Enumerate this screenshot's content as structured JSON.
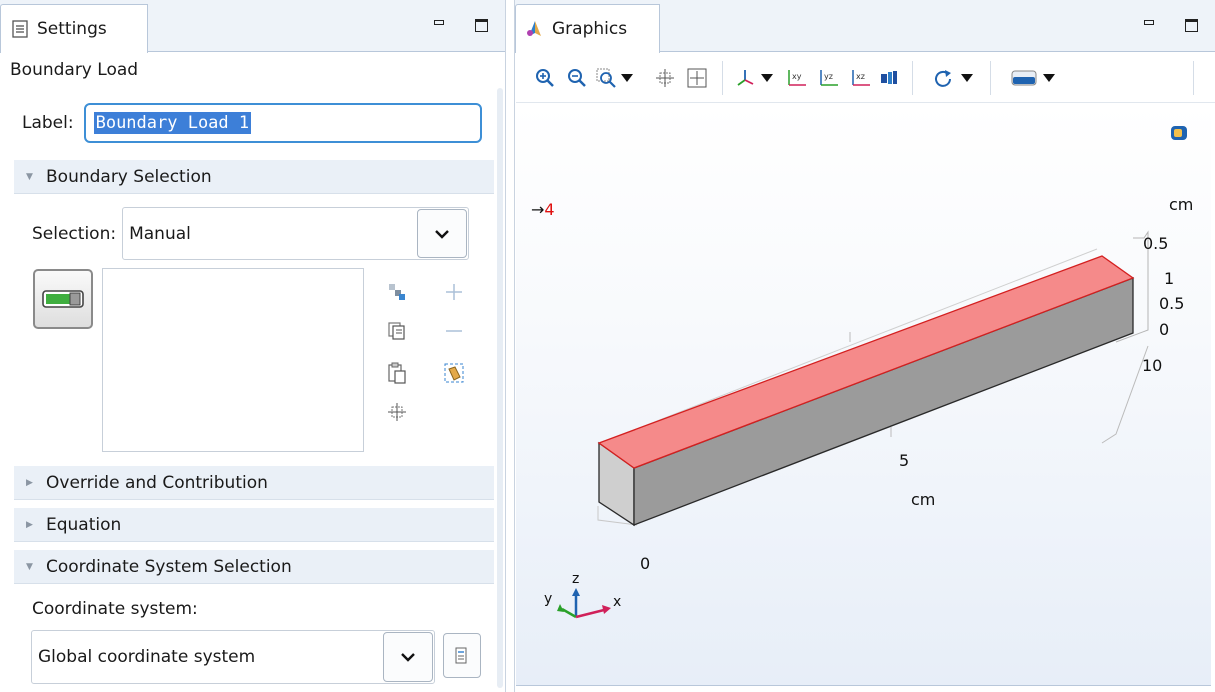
{
  "settings": {
    "tab_title": "Settings",
    "node_title": "Boundary Load",
    "label_caption": "Label:",
    "label_value": "Boundary Load 1",
    "sections": {
      "boundary_selection": "Boundary Selection",
      "override": "Override and Contribution",
      "equation": "Equation",
      "coordinate": "Coordinate System Selection"
    },
    "selection_caption": "Selection:",
    "selection_value": "Manual",
    "coord_caption": "Coordinate system:",
    "coord_value": "Global coordinate system",
    "icons": [
      "paste-selection-icon",
      "copy-icon",
      "clipboard-icon",
      "zoom-extents-icon",
      "add-icon",
      "remove-icon",
      "clear-selection-icon"
    ]
  },
  "graphics": {
    "tab_title": "Graphics",
    "arrow_label": "→",
    "arrow_number": "4",
    "axis": {
      "units_top": "cm",
      "ticks_right": [
        "0.5",
        "1",
        "0.5",
        "0",
        "10"
      ],
      "tick_mid": "5",
      "units_bottom": "cm",
      "tick_front": "0",
      "triad": {
        "x": "x",
        "y": "y",
        "z": "z"
      }
    },
    "colors": {
      "selected_face": "#f58a8a",
      "block_front": "#9b9b9b",
      "block_end": "#cfcfcf",
      "arrow_number": "#e01010"
    }
  }
}
